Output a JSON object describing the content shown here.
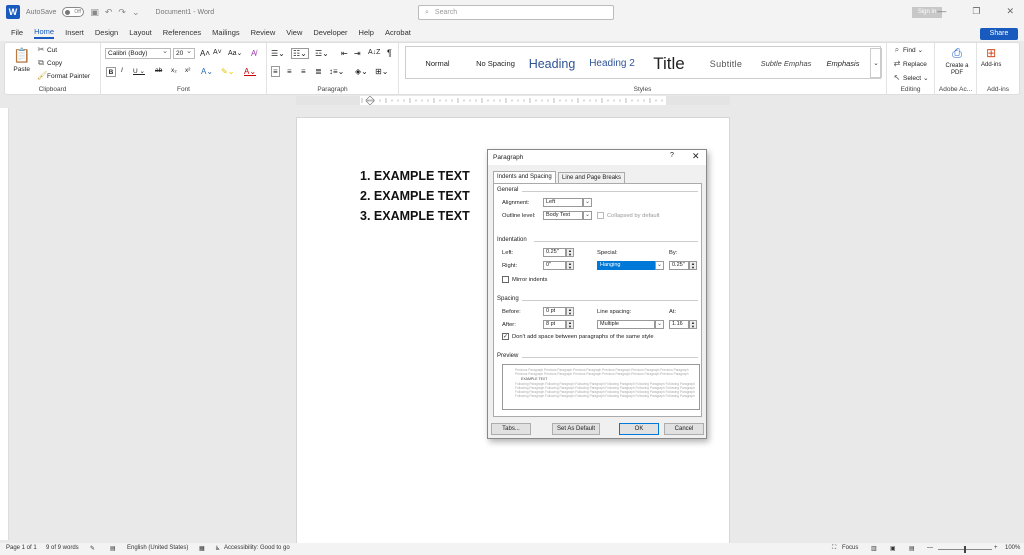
{
  "titlebar": {
    "autosave_label": "AutoSave",
    "autosave_state": "Off",
    "doc_title": "Document1 - Word",
    "search_placeholder": "Search",
    "signin": "Sign in"
  },
  "menu": [
    "File",
    "Home",
    "Insert",
    "Design",
    "Layout",
    "References",
    "Mailings",
    "Review",
    "View",
    "Developer",
    "Help",
    "Acrobat"
  ],
  "share": "Share",
  "ribbon": {
    "clipboard": {
      "paste": "Paste",
      "cut": "Cut",
      "copy": "Copy",
      "format_painter": "Format Painter",
      "label": "Clipboard"
    },
    "font": {
      "font_name": "Calibri (Body)",
      "font_size": "20",
      "label": "Font"
    },
    "paragraph": {
      "label": "Paragraph"
    },
    "styles": {
      "items": [
        "Normal",
        "No Spacing",
        "Heading",
        "Heading 2",
        "Title",
        "Subtitle",
        "Subtle Emphas",
        "Emphasis"
      ],
      "label": "Styles"
    },
    "editing": {
      "find": "Find",
      "replace": "Replace",
      "select": "Select",
      "label": "Editing"
    },
    "adobe": {
      "create_pdf": "Create a PDF",
      "label": "Adobe Ac..."
    },
    "addins": {
      "btn": "Add-ins",
      "label": "Add-ins"
    }
  },
  "document": {
    "lines": [
      "1. EXAMPLE TEXT",
      "2. EXAMPLE TEXT",
      "3. EXAMPLE TEXT"
    ]
  },
  "dialog": {
    "title": "Paragraph",
    "help": "?",
    "close": "✕",
    "tabs": [
      "Indents and Spacing",
      "Line and Page Breaks"
    ],
    "general": {
      "section": "General",
      "alignment_label": "Alignment:",
      "alignment": "Left",
      "outline_label": "Outline level:",
      "outline": "Body Text",
      "collapsed": "Collapsed by default"
    },
    "indentation": {
      "section": "Indentation",
      "left_label": "Left:",
      "left": "0.25\"",
      "right_label": "Right:",
      "right": "0\"",
      "special_label": "Special:",
      "special": "Hanging",
      "by_label": "By:",
      "by": "0.25\"",
      "mirror": "Mirror indents"
    },
    "spacing": {
      "section": "Spacing",
      "before_label": "Before:",
      "before": "0 pt",
      "after_label": "After:",
      "after": "8 pt",
      "line_label": "Line spacing:",
      "line": "Multiple",
      "at_label": "At:",
      "at": "1.16",
      "dont_add": "Don't add space between paragraphs of the same style"
    },
    "preview": {
      "section": "Preview",
      "sample": "EXAMPLE TEXT",
      "prev_text": "Previous Paragraph Previous Paragraph Previous Paragraph Previous Paragraph Previous Paragraph Previous Paragraph",
      "follow_text": "Following Paragraph Following Paragraph Following Paragraph Following Paragraph Following Paragraph Following Paragraph"
    },
    "buttons": {
      "tabs": "Tabs...",
      "set_default": "Set As Default",
      "ok": "OK",
      "cancel": "Cancel"
    }
  },
  "status": {
    "page": "Page 1 of 1",
    "words": "9 of 9 words",
    "language": "English (United States)",
    "accessibility": "Accessibility: Good to go",
    "focus": "Focus",
    "zoom": "100%"
  }
}
